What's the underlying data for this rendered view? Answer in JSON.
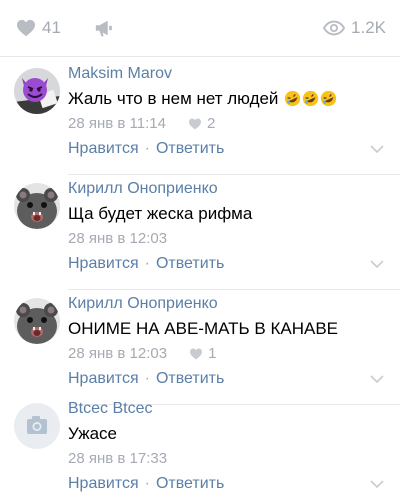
{
  "stats": {
    "likes": "41",
    "views": "1.2K"
  },
  "comments": [
    {
      "author": "Maksim Marov",
      "text": "Жаль что в нем нет людей",
      "date": "28 янв в 11:14",
      "likes": "2",
      "like_label": "Нравится",
      "reply_label": "Ответить"
    },
    {
      "author": "Кирилл Оноприенко",
      "text": "Ща будет жеска рифма",
      "date": "28 янв в 12:03",
      "like_label": "Нравится",
      "reply_label": "Ответить"
    },
    {
      "author": "Кирилл Оноприенко",
      "text": "ОНИМЕ НА АВЕ-МАТЬ В КАНАВЕ",
      "date": "28 янв в 12:03",
      "likes": "1",
      "like_label": "Нравится",
      "reply_label": "Ответить"
    },
    {
      "author": "Btcec Btcec",
      "text": "Ужасе",
      "date": "28 янв в 17:33",
      "like_label": "Нравится",
      "reply_label": "Ответить"
    }
  ],
  "colors": {
    "link": "#5b7fa6",
    "muted": "#a5aab3",
    "divider": "#e6e8eb"
  }
}
